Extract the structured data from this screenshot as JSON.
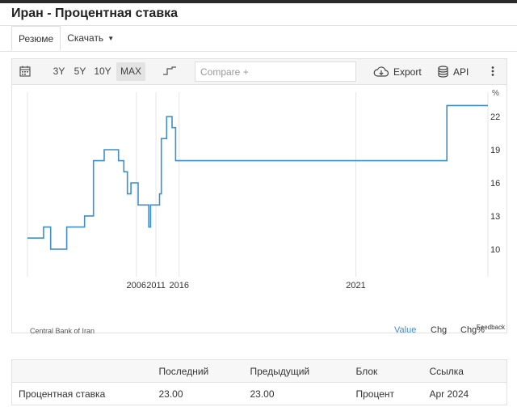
{
  "page": {
    "title": "Иран - Процентная ставка"
  },
  "tabs": [
    {
      "label": "Резюме",
      "active": true
    },
    {
      "label": "Скачать",
      "has_dropdown": true
    }
  ],
  "toolbar": {
    "calendar_icon": "calendar-icon",
    "ranges": [
      {
        "label": "3Y",
        "active": false
      },
      {
        "label": "5Y",
        "active": false
      },
      {
        "label": "10Y",
        "active": false
      },
      {
        "label": "MAX",
        "active": true
      }
    ],
    "chart_style_icon": "step-line-icon",
    "compare_placeholder": "Compare +",
    "export_label": "Export",
    "export_icon": "cloud-download-icon",
    "api_label": "API",
    "api_icon": "database-icon",
    "more_icon": "more-vertical-icon"
  },
  "chart_data": {
    "type": "line",
    "step": true,
    "color": "#3d8fc9",
    "unit_label": "%",
    "xlim": [
      2000.3,
      2026.1
    ],
    "ylim": [
      7.5,
      24.2
    ],
    "x_ticks": [
      {
        "label": "2006",
        "value": 2006.4
      },
      {
        "label": "2011",
        "value": 2007.5
      },
      {
        "label": "2016",
        "value": 2008.8
      },
      {
        "label": "2021",
        "value": 2018.7
      }
    ],
    "y_ticks": [
      10,
      13,
      16,
      19,
      22
    ],
    "grid": "vertical",
    "source": "Central Bank of Iran",
    "series": [
      {
        "x": [
          2000.3,
          2001.2,
          2001.6,
          2002.5,
          2003.5,
          2004.0,
          2004.6,
          2005.4,
          2005.7,
          2005.9,
          2006.1,
          2006.5,
          2007.1,
          2007.2,
          2007.7,
          2007.8,
          2008.1,
          2008.4,
          2008.6,
          2023.8,
          2026.1
        ],
        "y": [
          11,
          12,
          10,
          12,
          13,
          18,
          19,
          18,
          17,
          15,
          16,
          14,
          12,
          14,
          15,
          20,
          22,
          21,
          18,
          23,
          23
        ]
      }
    ]
  },
  "modes": [
    {
      "label": "Value",
      "active": true
    },
    {
      "label": "Chg",
      "active": false
    },
    {
      "label": "Chg%",
      "active": false
    }
  ],
  "feedback_label": "Feedback",
  "table": {
    "headers": [
      "",
      "Последний",
      "Предыдущий",
      "Блок",
      "Ссылка"
    ],
    "rows": [
      [
        "Процентная ставка",
        "23.00",
        "23.00",
        "Процент",
        "Apr 2024"
      ]
    ]
  }
}
